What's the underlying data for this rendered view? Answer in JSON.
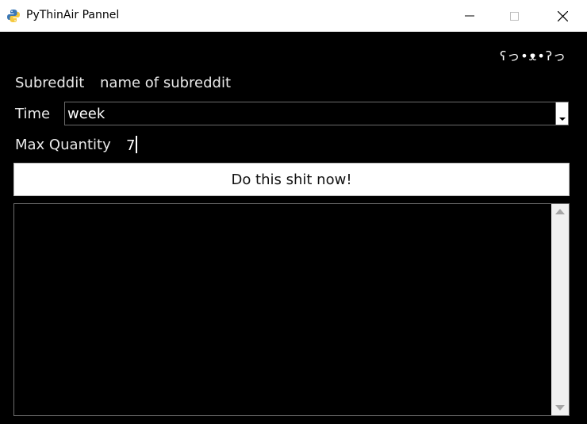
{
  "window": {
    "title": "PyThinAir Pannel",
    "app_icon": "python-icon",
    "controls": [
      "minimize-icon",
      "maximize-icon",
      "close-icon"
    ]
  },
  "header": {
    "kaomoji": "ʕっ•ᴥ•ʔっ"
  },
  "form": {
    "subreddit_label": "Subreddit",
    "subreddit_value": "name of subreddit",
    "time_label": "Time",
    "time_value": "week",
    "max_label": "Max Quantity",
    "max_value": "7"
  },
  "action": {
    "button_label": "Do this shit now!"
  },
  "output": {
    "text": ""
  },
  "colors": {
    "background": "#000000",
    "titlebar": "#ffffff",
    "button": "#ffffff",
    "text": "#ffffff"
  }
}
